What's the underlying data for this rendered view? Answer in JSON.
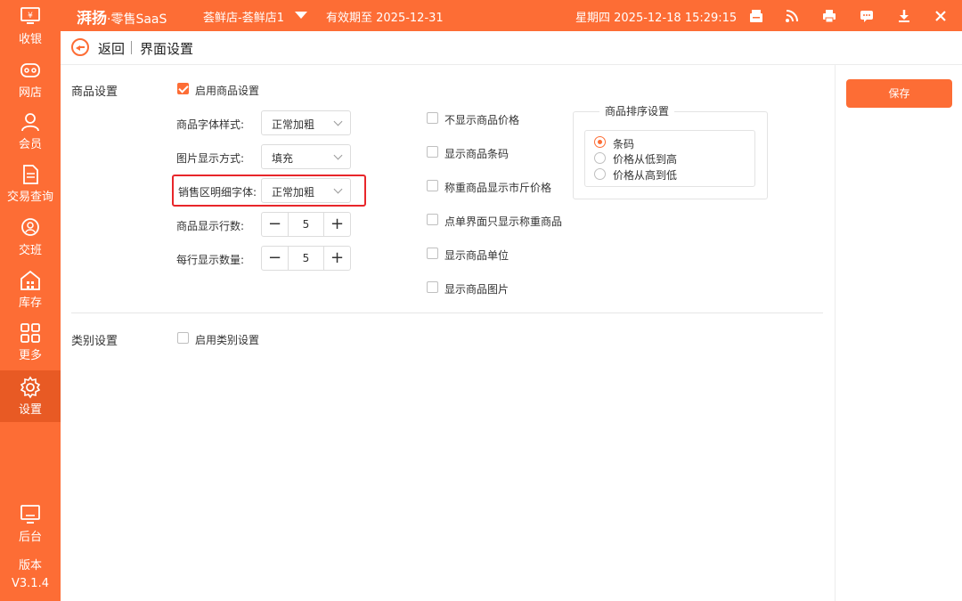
{
  "topbar": {
    "brand": "湃扬",
    "brand_sub": "·零售SaaS",
    "store": "荟鲜店-荟鲜店1",
    "expiry": "有效期至 2025-12-31",
    "datetime": "星期四 2025-12-18 15:29:15",
    "icons": [
      "cash-drawer-icon",
      "rss-icon",
      "printer-icon",
      "message-icon",
      "download-icon",
      "close-icon"
    ]
  },
  "sidebar": {
    "items": [
      {
        "label": "收银",
        "icon": "cashier-icon"
      },
      {
        "label": "网店",
        "icon": "online-store-icon"
      },
      {
        "label": "会员",
        "icon": "member-icon"
      },
      {
        "label": "交易查询",
        "icon": "transaction-query-icon"
      },
      {
        "label": "交班",
        "icon": "shift-handover-icon"
      },
      {
        "label": "库存",
        "icon": "inventory-icon"
      },
      {
        "label": "更多",
        "icon": "more-grid-icon"
      },
      {
        "label": "设置",
        "icon": "settings-gear-icon",
        "active": true
      },
      {
        "label": "后台",
        "icon": "backend-monitor-icon"
      }
    ],
    "version_label": "版本",
    "version": "V3.1.4"
  },
  "header": {
    "back": "返回",
    "title": "界面设置"
  },
  "save_label": "保存",
  "goods": {
    "section_title": "商品设置",
    "enable_label": "启用商品设置",
    "enable_checked": true,
    "font_style_label": "商品字体样式:",
    "font_style_value": "正常加粗",
    "image_mode_label": "图片显示方式:",
    "image_mode_value": "填充",
    "detail_font_label": "销售区明细字体:",
    "detail_font_value": "正常加粗",
    "rows_label": "商品显示行数:",
    "rows_value": "5",
    "per_row_label": "每行显示数量:",
    "per_row_value": "5",
    "options": [
      {
        "label": "不显示商品价格",
        "checked": false
      },
      {
        "label": "显示商品条码",
        "checked": false
      },
      {
        "label": "称重商品显示市斤价格",
        "checked": false
      },
      {
        "label": "点单界面只显示称重商品",
        "checked": false
      },
      {
        "label": "显示商品单位",
        "checked": false
      },
      {
        "label": "显示商品图片",
        "checked": false
      }
    ],
    "sort": {
      "title": "商品排序设置",
      "options": [
        {
          "label": "条码",
          "selected": true
        },
        {
          "label": "价格从低到高",
          "selected": false
        },
        {
          "label": "价格从高到低",
          "selected": false
        }
      ]
    }
  },
  "category": {
    "section_title": "类别设置",
    "enable_label": "启用类别设置",
    "enable_checked": false
  },
  "colors": {
    "accent": "#fd6d35",
    "highlight_border": "#e8262a"
  }
}
